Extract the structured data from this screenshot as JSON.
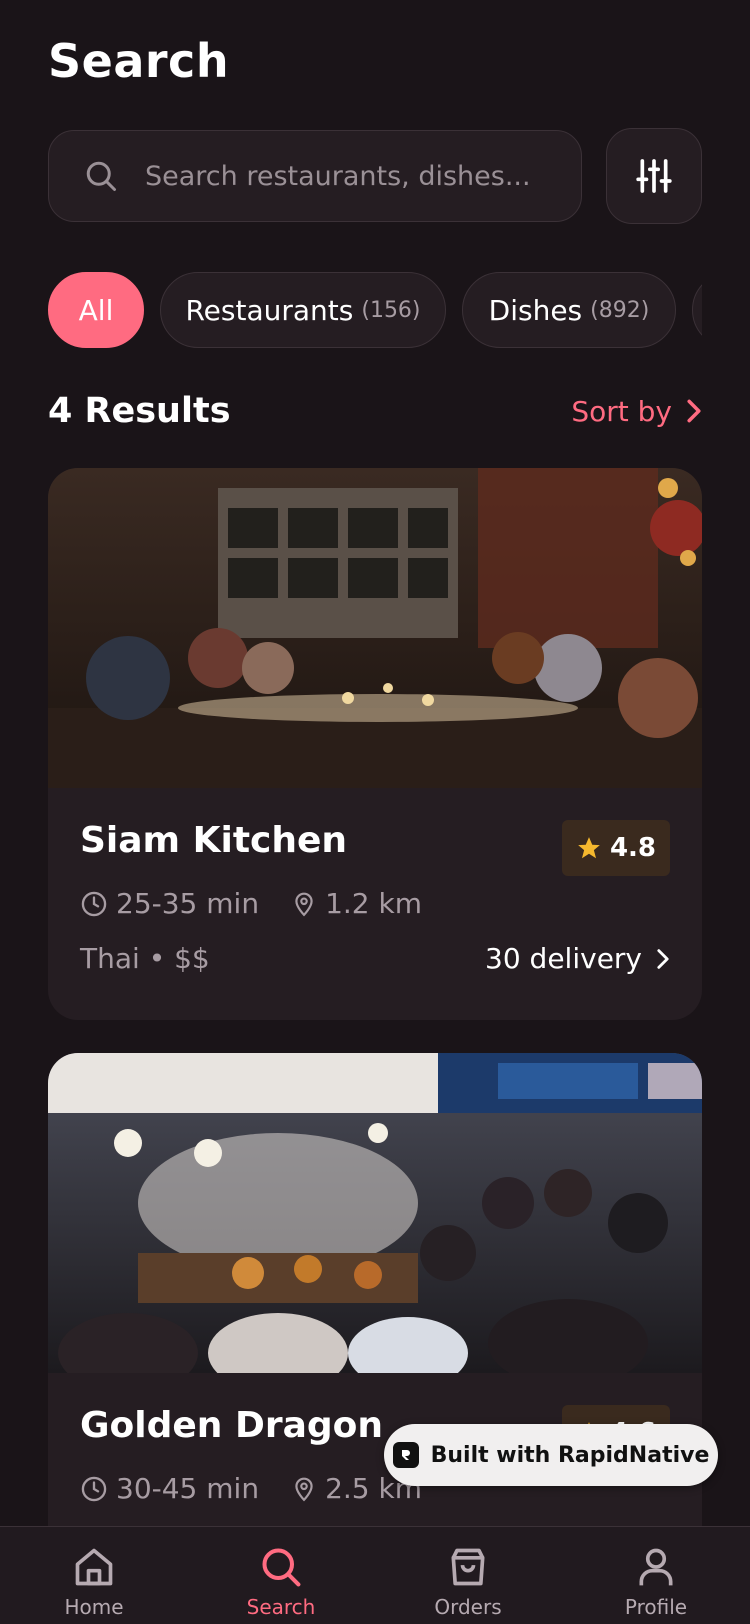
{
  "header": {
    "title": "Search"
  },
  "search": {
    "placeholder": "Search restaurants, dishes..."
  },
  "chips": [
    {
      "label": "All",
      "count": "",
      "active": true
    },
    {
      "label": "Restaurants",
      "count": "(156)"
    },
    {
      "label": "Dishes",
      "count": "(892)"
    }
  ],
  "results": {
    "count_label": "4 Results",
    "sort_label": "Sort by"
  },
  "restaurants": [
    {
      "name": "Siam Kitchen",
      "rating": "4.8",
      "time": "25-35 min",
      "distance": "1.2 km",
      "cuisine": "Thai • $$",
      "delivery": "30 delivery"
    },
    {
      "name": "Golden Dragon",
      "rating": "4.6",
      "time": "30-45 min",
      "distance": "2.5 km"
    }
  ],
  "badge": {
    "label": "Built with RapidNative"
  },
  "tabbar": {
    "items": [
      {
        "label": "Home",
        "icon": "home-icon"
      },
      {
        "label": "Search",
        "icon": "search-icon",
        "active": true
      },
      {
        "label": "Orders",
        "icon": "shopping-bag-icon"
      },
      {
        "label": "Profile",
        "icon": "user-icon"
      }
    ]
  },
  "colors": {
    "background": "#1a1418",
    "surface": "#251d22",
    "accent": "#ff6b81",
    "star": "#f5b82e"
  }
}
